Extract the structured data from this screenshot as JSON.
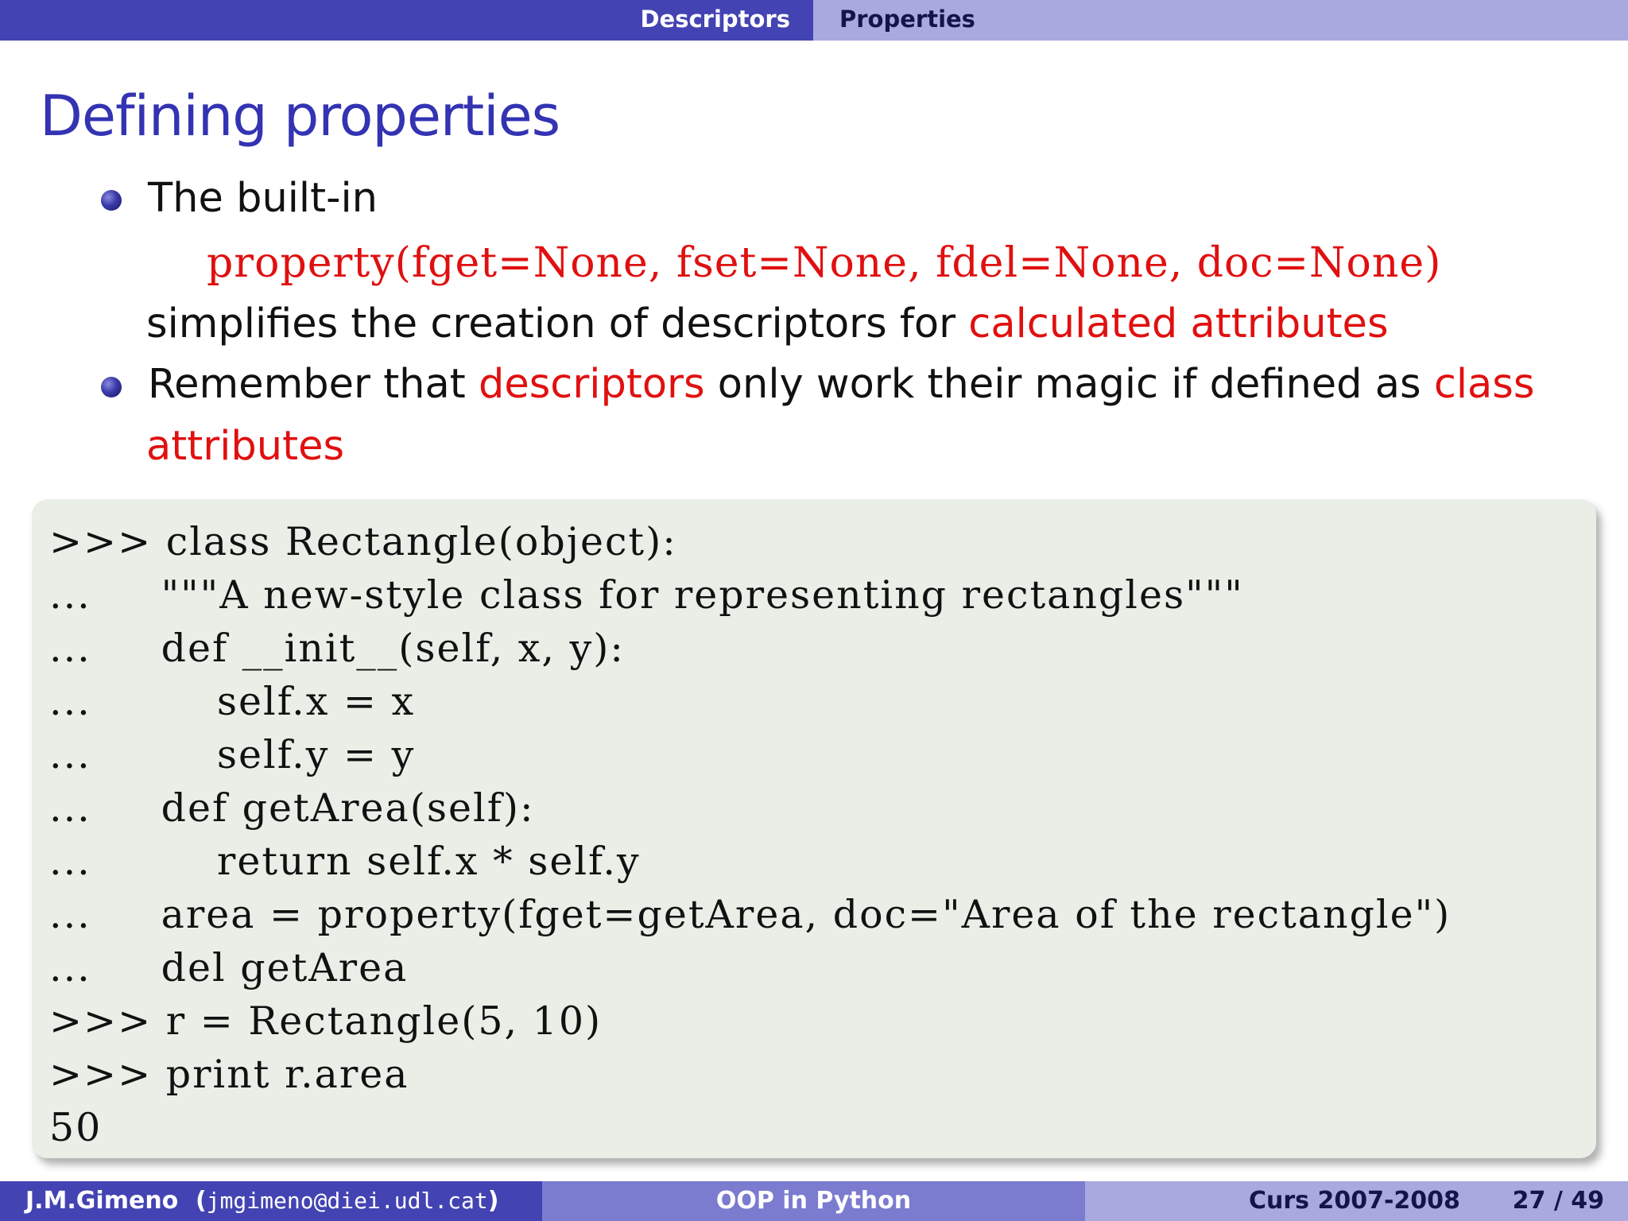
{
  "nav": {
    "sections": [
      "Descriptors",
      "Properties"
    ]
  },
  "slide": {
    "title": "Defining properties",
    "bullet1": {
      "line1": "The built-in",
      "code": "property(fget=None, fset=None, fdel=None, doc=None)",
      "line3_prefix": "simplifies the creation of descriptors for ",
      "line3_highlight": "calculated attributes"
    },
    "bullet2": {
      "prefix": "Remember that ",
      "highlight1": "descriptors",
      "middle": " only work their magic if defined as ",
      "highlight2a": "class",
      "highlight2b": "attributes"
    },
    "code_lines": [
      ">>> class Rectangle(object):",
      "...     \"\"\"A new-style class for representing rectangles\"\"\"",
      "...     def __init__(self, x, y):",
      "...         self.x = x",
      "...         self.y = y",
      "...     def getArea(self):",
      "...         return self.x * self.y",
      "...     area = property(fget=getArea, doc=\"Area of the rectangle\")",
      "...     del getArea",
      ">>> r = Rectangle(5, 10)",
      ">>> print r.area",
      "50"
    ]
  },
  "footer": {
    "author": "J.M.Gimeno",
    "email_open": "(",
    "email": "jmgimeno@diei.udl.cat",
    "email_close": ")",
    "title": "OOP in Python",
    "course": "Curs 2007-2008",
    "page": "27 / 49"
  },
  "colors": {
    "nav_dark": "#4343b3",
    "nav_light": "#a9a9e0",
    "title": "#3333b3",
    "highlight": "#e01010",
    "code_bg": "#e9efe7"
  }
}
